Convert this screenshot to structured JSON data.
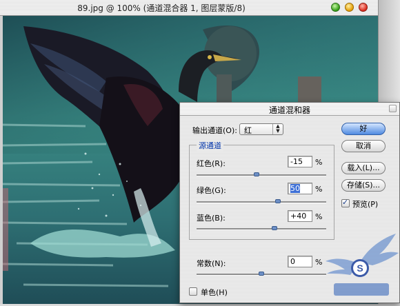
{
  "window": {
    "title": "89.jpg @ 100% (通道混合器 1, 图层蒙版/8)"
  },
  "dialog": {
    "title": "通道混和器",
    "output_channel": {
      "label": "输出通道(O):",
      "value": "红"
    },
    "source_group_title": "源通道",
    "channels": [
      {
        "label": "红色(R):",
        "value": "-15",
        "unit": "%",
        "level": -15
      },
      {
        "label": "绿色(G):",
        "value": "50",
        "unit": "%",
        "level": 50
      },
      {
        "label": "蓝色(B):",
        "value": "+40",
        "unit": "%",
        "level": 40
      }
    ],
    "constant": {
      "label": "常数(N):",
      "value": "0",
      "unit": "%",
      "level": 0
    },
    "monochrome": {
      "label": "单色(H)",
      "checked": false
    },
    "preview": {
      "label": "预览(P)",
      "checked": true
    },
    "buttons": {
      "ok": "好",
      "cancel": "取消",
      "load": "载入(L)...",
      "save": "存储(S)..."
    }
  },
  "colors": {
    "accent_blue": "#3d6fd6",
    "group_title": "#0033aa",
    "water_teal": "#2f7a77"
  }
}
